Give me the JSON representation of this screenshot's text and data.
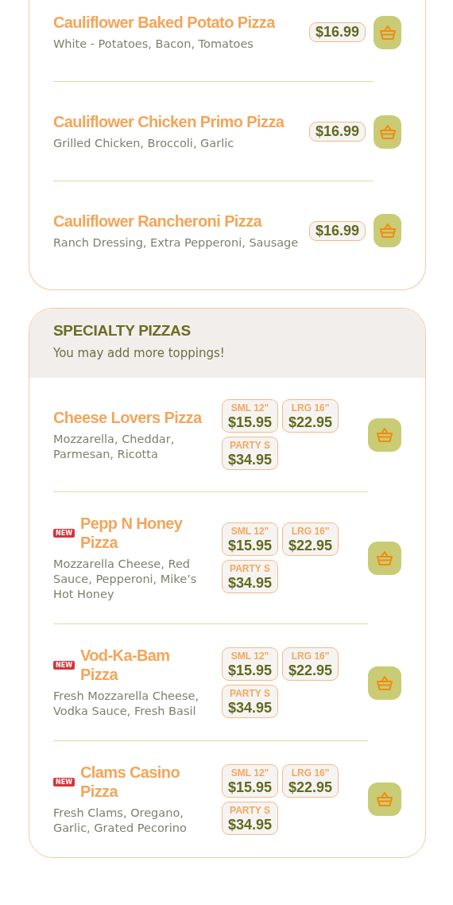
{
  "sections": [
    {
      "items": [
        {
          "kind": "single",
          "name": "Cauliflower Baked Potato Pizza",
          "description": "White - Potatoes, Bacon, Tomatoes",
          "price": "$16.99"
        },
        {
          "kind": "single",
          "name": "Cauliflower Chicken Primo Pizza",
          "description": "Grilled Chicken, Broccoli, Garlic",
          "price": "$16.99"
        },
        {
          "kind": "single",
          "name": "Cauliflower Rancheroni Pizza",
          "description": "Ranch Dressing, Extra Pepperoni, Sausage",
          "price": "$16.99"
        }
      ]
    },
    {
      "title": "SPECIALTY PIZZAS",
      "subtitle": "You may add more toppings!",
      "items": [
        {
          "kind": "sized",
          "name": "Cheese Lovers Pizza",
          "description": "Mozzarella, Cheddar, Parmesan, Ricotta",
          "prices": [
            {
              "size": "SML 12\"",
              "price": "$15.95"
            },
            {
              "size": "LRG 16\"",
              "price": "$22.95"
            },
            {
              "size": "PARTY S",
              "price": "$34.95"
            }
          ]
        },
        {
          "kind": "sized",
          "badge": "NEW",
          "name": "Pepp N Honey Pizza",
          "description": "Mozzarella Cheese, Red Sauce, Pepperoni, Mike’s Hot Honey",
          "prices": [
            {
              "size": "SML 12\"",
              "price": "$15.95"
            },
            {
              "size": "LRG 16\"",
              "price": "$22.95"
            },
            {
              "size": "PARTY S",
              "price": "$34.95"
            }
          ]
        },
        {
          "kind": "sized",
          "badge": "NEW",
          "name": "Vod-Ka-Bam Pizza",
          "description": "Fresh Mozzarella Cheese, Vodka Sauce, Fresh Basil",
          "prices": [
            {
              "size": "SML 12\"",
              "price": "$15.95"
            },
            {
              "size": "LRG 16\"",
              "price": "$22.95"
            },
            {
              "size": "PARTY S",
              "price": "$34.95"
            }
          ]
        },
        {
          "kind": "sized",
          "badge": "NEW",
          "name": "Clams Casino Pizza",
          "description": "Fresh Clams, Oregano, Garlic, Grated Pecorino",
          "prices": [
            {
              "size": "SML 12\"",
              "price": "$15.95"
            },
            {
              "size": "LRG 16\"",
              "price": "$22.95"
            },
            {
              "size": "PARTY S",
              "price": "$34.95"
            }
          ]
        }
      ]
    }
  ]
}
